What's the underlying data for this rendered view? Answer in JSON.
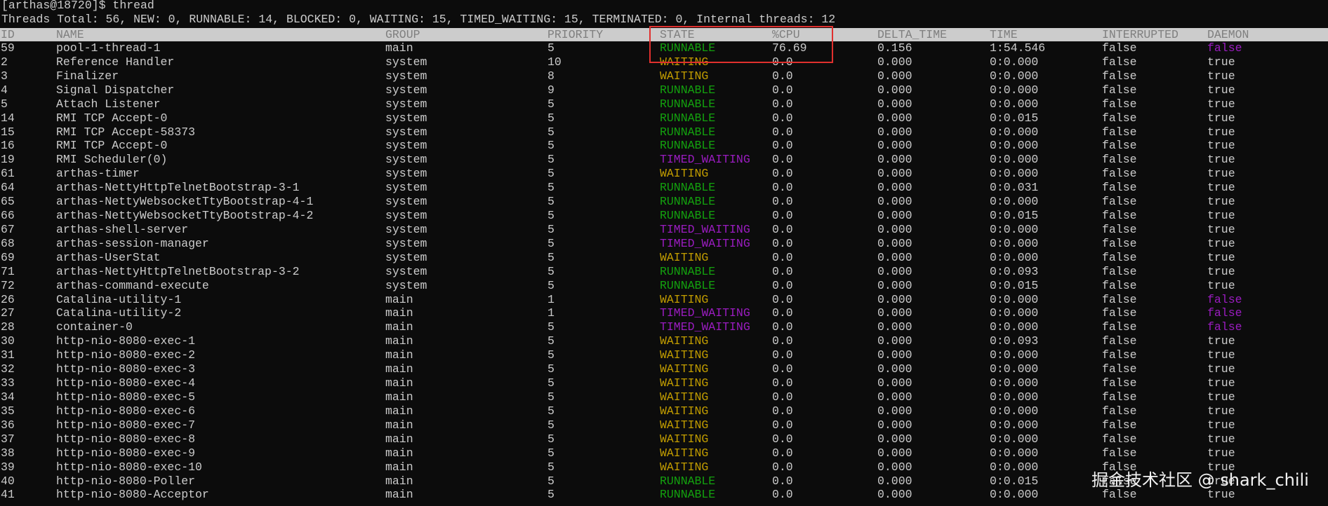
{
  "terminal": {
    "prompt": "[arthas@18720]$ thread",
    "summary": "Threads Total: 56, NEW: 0, RUNNABLE: 14, BLOCKED: 0, WAITING: 15, TIMED_WAITING: 15, TERMINATED: 0, Internal threads: 12"
  },
  "table": {
    "headers": [
      "ID",
      "NAME",
      "GROUP",
      "PRIORITY",
      "STATE",
      "%CPU",
      "DELTA_TIME",
      "TIME",
      "INTERRUPTED",
      "DAEMON"
    ],
    "rows": [
      [
        "59",
        "pool-1-thread-1",
        "main",
        "5",
        "RUNNABLE",
        "76.69",
        "0.156",
        "1:54.546",
        "false",
        "false"
      ],
      [
        "2",
        "Reference Handler",
        "system",
        "10",
        "WAITING",
        "0.0",
        "0.000",
        "0:0.000",
        "false",
        "true"
      ],
      [
        "3",
        "Finalizer",
        "system",
        "8",
        "WAITING",
        "0.0",
        "0.000",
        "0:0.000",
        "false",
        "true"
      ],
      [
        "4",
        "Signal Dispatcher",
        "system",
        "9",
        "RUNNABLE",
        "0.0",
        "0.000",
        "0:0.000",
        "false",
        "true"
      ],
      [
        "5",
        "Attach Listener",
        "system",
        "5",
        "RUNNABLE",
        "0.0",
        "0.000",
        "0:0.000",
        "false",
        "true"
      ],
      [
        "14",
        "RMI TCP Accept-0",
        "system",
        "5",
        "RUNNABLE",
        "0.0",
        "0.000",
        "0:0.015",
        "false",
        "true"
      ],
      [
        "15",
        "RMI TCP Accept-58373",
        "system",
        "5",
        "RUNNABLE",
        "0.0",
        "0.000",
        "0:0.000",
        "false",
        "true"
      ],
      [
        "16",
        "RMI TCP Accept-0",
        "system",
        "5",
        "RUNNABLE",
        "0.0",
        "0.000",
        "0:0.000",
        "false",
        "true"
      ],
      [
        "19",
        "RMI Scheduler(0)",
        "system",
        "5",
        "TIMED_WAITING",
        "0.0",
        "0.000",
        "0:0.000",
        "false",
        "true"
      ],
      [
        "61",
        "arthas-timer",
        "system",
        "5",
        "WAITING",
        "0.0",
        "0.000",
        "0:0.000",
        "false",
        "true"
      ],
      [
        "64",
        "arthas-NettyHttpTelnetBootstrap-3-1",
        "system",
        "5",
        "RUNNABLE",
        "0.0",
        "0.000",
        "0:0.031",
        "false",
        "true"
      ],
      [
        "65",
        "arthas-NettyWebsocketTtyBootstrap-4-1",
        "system",
        "5",
        "RUNNABLE",
        "0.0",
        "0.000",
        "0:0.000",
        "false",
        "true"
      ],
      [
        "66",
        "arthas-NettyWebsocketTtyBootstrap-4-2",
        "system",
        "5",
        "RUNNABLE",
        "0.0",
        "0.000",
        "0:0.015",
        "false",
        "true"
      ],
      [
        "67",
        "arthas-shell-server",
        "system",
        "5",
        "TIMED_WAITING",
        "0.0",
        "0.000",
        "0:0.000",
        "false",
        "true"
      ],
      [
        "68",
        "arthas-session-manager",
        "system",
        "5",
        "TIMED_WAITING",
        "0.0",
        "0.000",
        "0:0.000",
        "false",
        "true"
      ],
      [
        "69",
        "arthas-UserStat",
        "system",
        "5",
        "WAITING",
        "0.0",
        "0.000",
        "0:0.000",
        "false",
        "true"
      ],
      [
        "71",
        "arthas-NettyHttpTelnetBootstrap-3-2",
        "system",
        "5",
        "RUNNABLE",
        "0.0",
        "0.000",
        "0:0.093",
        "false",
        "true"
      ],
      [
        "72",
        "arthas-command-execute",
        "system",
        "5",
        "RUNNABLE",
        "0.0",
        "0.000",
        "0:0.015",
        "false",
        "true"
      ],
      [
        "26",
        "Catalina-utility-1",
        "main",
        "1",
        "WAITING",
        "0.0",
        "0.000",
        "0:0.000",
        "false",
        "false"
      ],
      [
        "27",
        "Catalina-utility-2",
        "main",
        "1",
        "TIMED_WAITING",
        "0.0",
        "0.000",
        "0:0.000",
        "false",
        "false"
      ],
      [
        "28",
        "container-0",
        "main",
        "5",
        "TIMED_WAITING",
        "0.0",
        "0.000",
        "0:0.000",
        "false",
        "false"
      ],
      [
        "30",
        "http-nio-8080-exec-1",
        "main",
        "5",
        "WAITING",
        "0.0",
        "0.000",
        "0:0.093",
        "false",
        "true"
      ],
      [
        "31",
        "http-nio-8080-exec-2",
        "main",
        "5",
        "WAITING",
        "0.0",
        "0.000",
        "0:0.000",
        "false",
        "true"
      ],
      [
        "32",
        "http-nio-8080-exec-3",
        "main",
        "5",
        "WAITING",
        "0.0",
        "0.000",
        "0:0.000",
        "false",
        "true"
      ],
      [
        "33",
        "http-nio-8080-exec-4",
        "main",
        "5",
        "WAITING",
        "0.0",
        "0.000",
        "0:0.000",
        "false",
        "true"
      ],
      [
        "34",
        "http-nio-8080-exec-5",
        "main",
        "5",
        "WAITING",
        "0.0",
        "0.000",
        "0:0.000",
        "false",
        "true"
      ],
      [
        "35",
        "http-nio-8080-exec-6",
        "main",
        "5",
        "WAITING",
        "0.0",
        "0.000",
        "0:0.000",
        "false",
        "true"
      ],
      [
        "36",
        "http-nio-8080-exec-7",
        "main",
        "5",
        "WAITING",
        "0.0",
        "0.000",
        "0:0.000",
        "false",
        "true"
      ],
      [
        "37",
        "http-nio-8080-exec-8",
        "main",
        "5",
        "WAITING",
        "0.0",
        "0.000",
        "0:0.000",
        "false",
        "true"
      ],
      [
        "38",
        "http-nio-8080-exec-9",
        "main",
        "5",
        "WAITING",
        "0.0",
        "0.000",
        "0:0.000",
        "false",
        "true"
      ],
      [
        "39",
        "http-nio-8080-exec-10",
        "main",
        "5",
        "WAITING",
        "0.0",
        "0.000",
        "0:0.000",
        "false",
        "true"
      ],
      [
        "40",
        "http-nio-8080-Poller",
        "main",
        "5",
        "RUNNABLE",
        "0.0",
        "0.000",
        "0:0.015",
        "false",
        "true"
      ],
      [
        "41",
        "http-nio-8080-Acceptor",
        "main",
        "5",
        "RUNNABLE",
        "0.0",
        "0.000",
        "0:0.000",
        "false",
        "true"
      ]
    ]
  },
  "colors": {
    "background": "#0c0c0c",
    "text": "#cccccc",
    "runnable": "#13a10e",
    "waiting": "#c19c00",
    "timed_waiting": "#9a1cc0",
    "highlight_box": "#e0302e"
  },
  "watermark": "掘金技术社区 @ shark_chili"
}
